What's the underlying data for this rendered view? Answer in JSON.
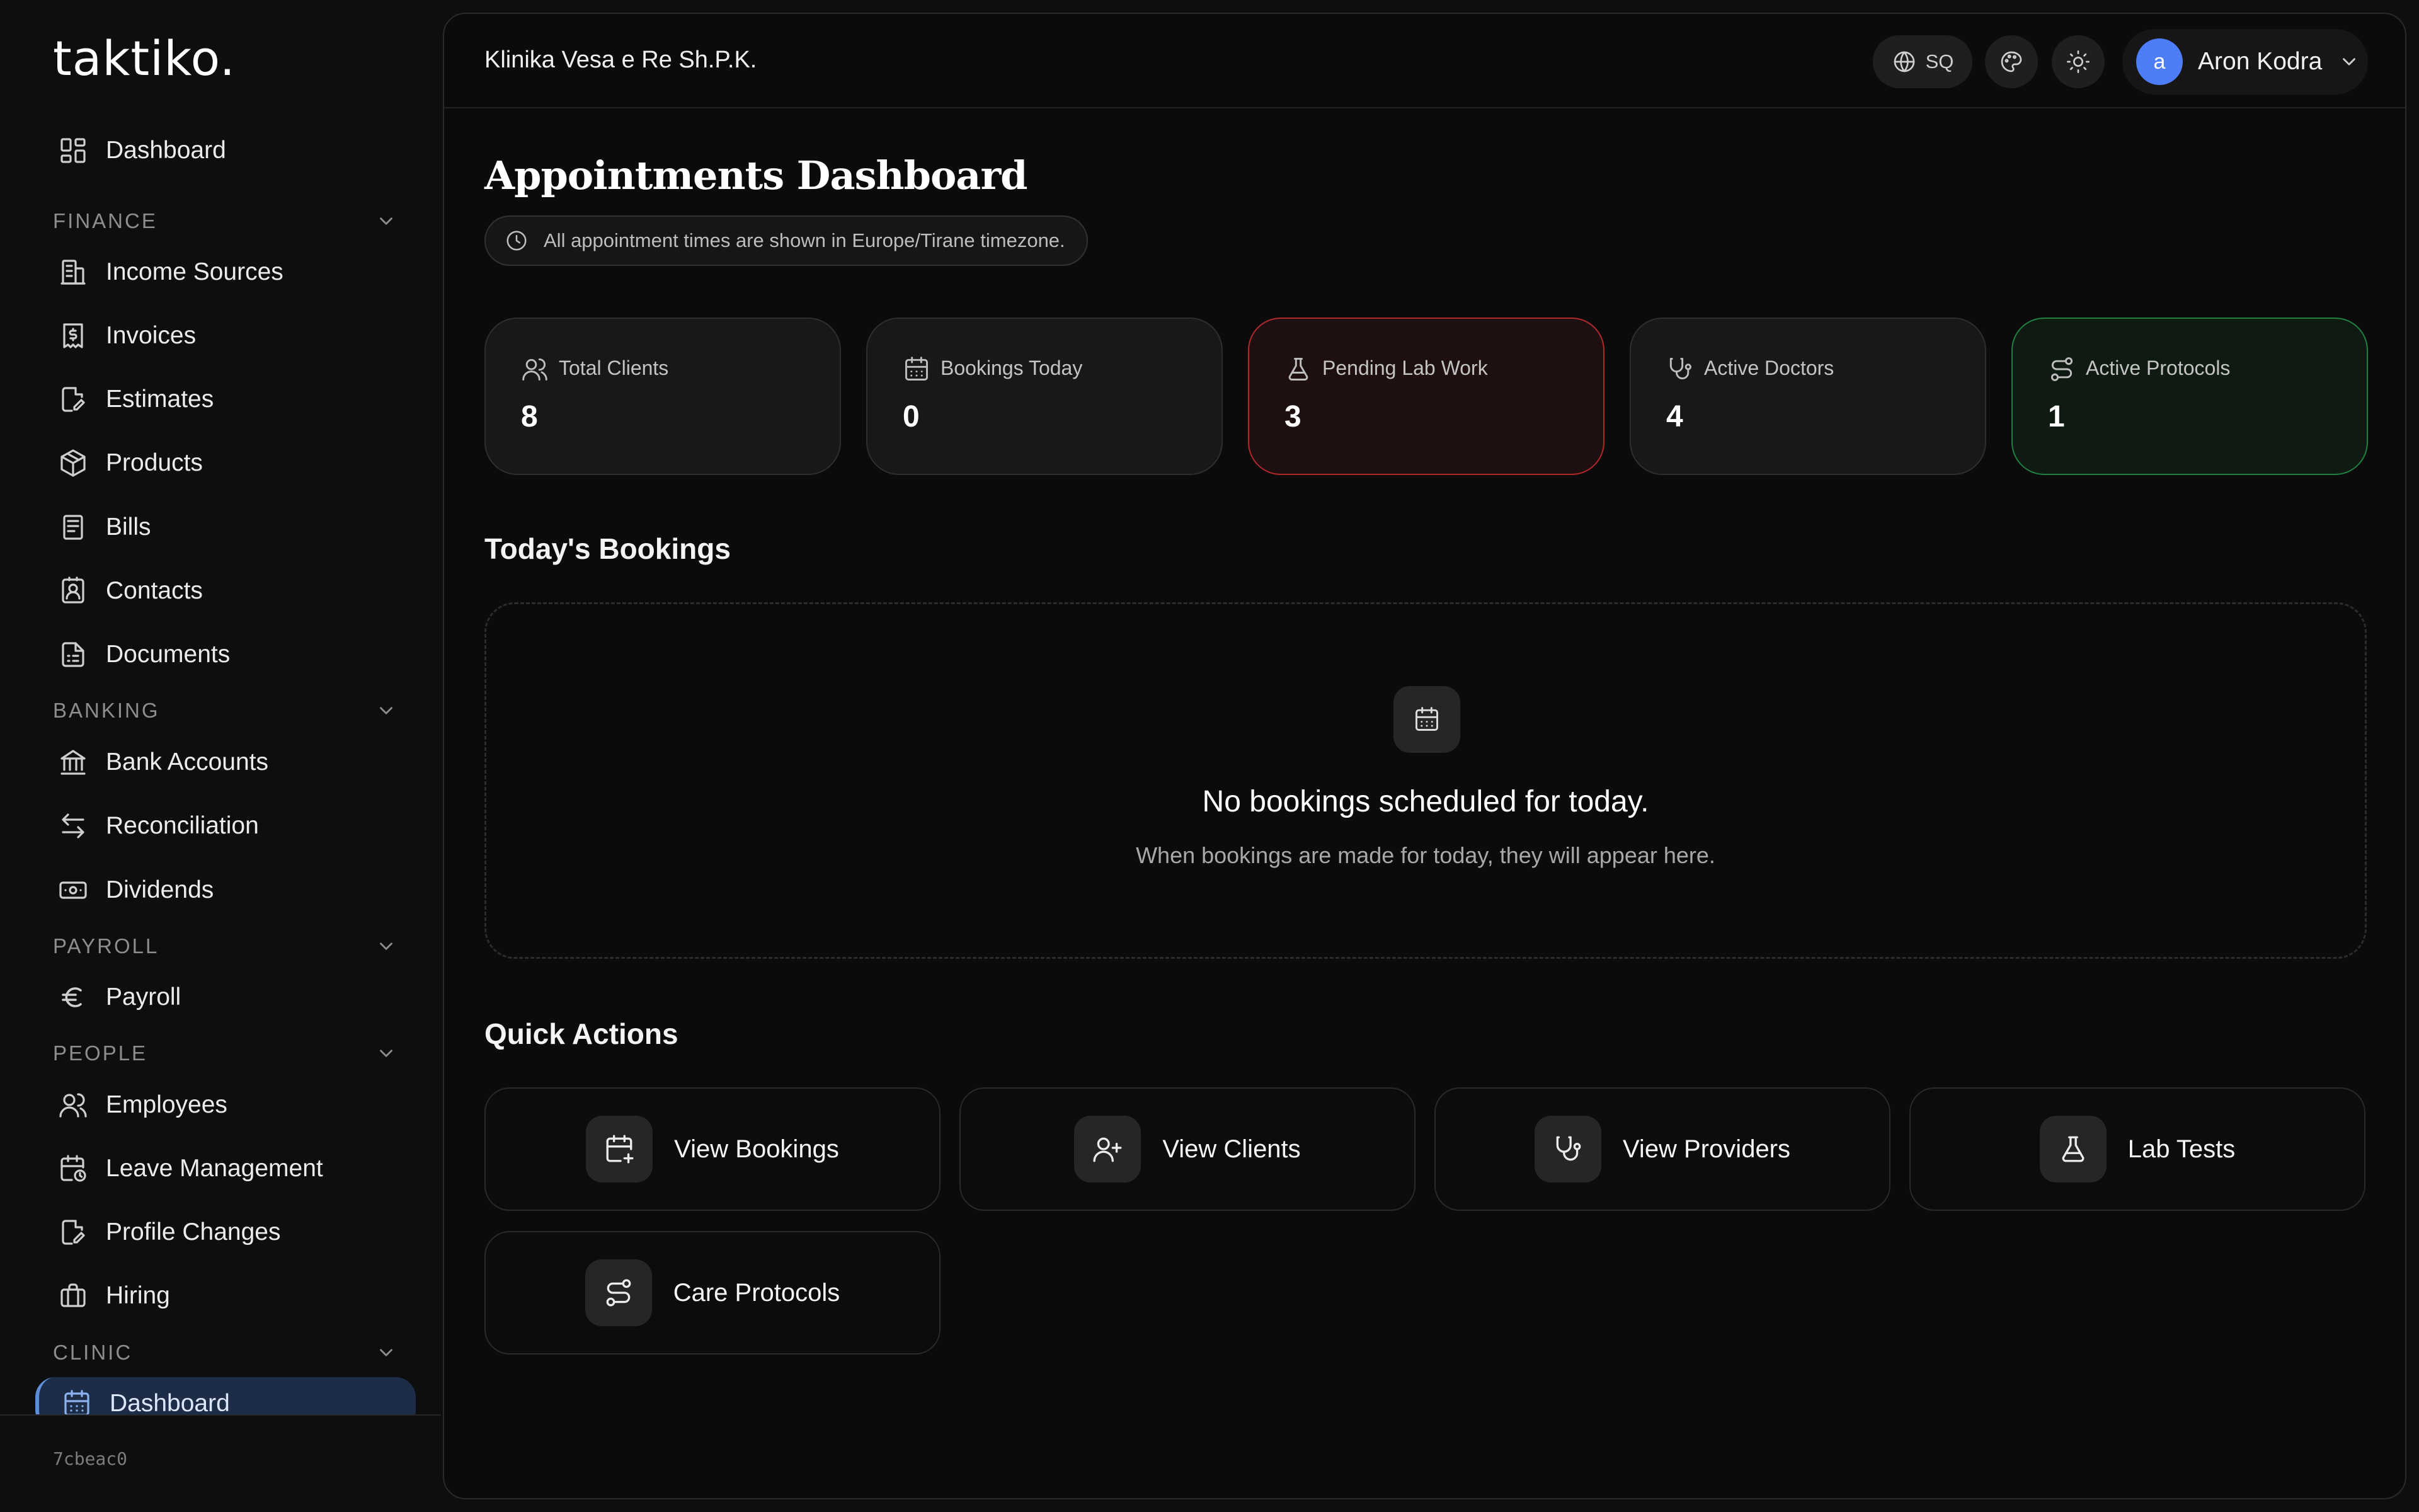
{
  "sidebar": {
    "logo": "taktiko.",
    "dashboard": "Dashboard",
    "sections": {
      "finance": "FINANCE",
      "banking": "BANKING",
      "payroll": "PAYROLL",
      "people": "PEOPLE",
      "clinic": "CLINIC"
    },
    "finance_items": [
      "Income Sources",
      "Invoices",
      "Estimates",
      "Products",
      "Bills",
      "Contacts",
      "Documents"
    ],
    "banking_items": [
      "Bank Accounts",
      "Reconciliation",
      "Dividends"
    ],
    "payroll_items": [
      "Payroll"
    ],
    "people_items": [
      "Employees",
      "Leave Management",
      "Profile Changes",
      "Hiring"
    ],
    "clinic_items": [
      "Dashboard"
    ],
    "version": "7cbeac0"
  },
  "header": {
    "company": "Klinika Vesa e Re Sh.P.K.",
    "language": "SQ",
    "user_initial": "a",
    "user_name": "Aron Kodra"
  },
  "page": {
    "title": "Appointments Dashboard",
    "timezone_note": "All appointment times are shown in Europe/Tirane timezone."
  },
  "stats": [
    {
      "label": "Total Clients",
      "value": "8",
      "icon": "users-icon"
    },
    {
      "label": "Bookings Today",
      "value": "0",
      "icon": "calendar-icon"
    },
    {
      "label": "Pending Lab Work",
      "value": "3",
      "icon": "flask-icon"
    },
    {
      "label": "Active Doctors",
      "value": "4",
      "icon": "stethoscope-icon"
    },
    {
      "label": "Active Protocols",
      "value": "1",
      "icon": "route-icon"
    }
  ],
  "bookings": {
    "heading": "Today's Bookings",
    "empty_title": "No bookings scheduled for today.",
    "empty_sub": "When bookings are made for today, they will appear here."
  },
  "quick_actions": {
    "heading": "Quick Actions",
    "items": [
      "View Bookings",
      "View Clients",
      "View Providers",
      "Lab Tests",
      "Care Protocols"
    ]
  },
  "colors": {
    "accent_blue": "#4d7ef7",
    "alert_red": "#b0282a",
    "success_green": "#20803f"
  }
}
